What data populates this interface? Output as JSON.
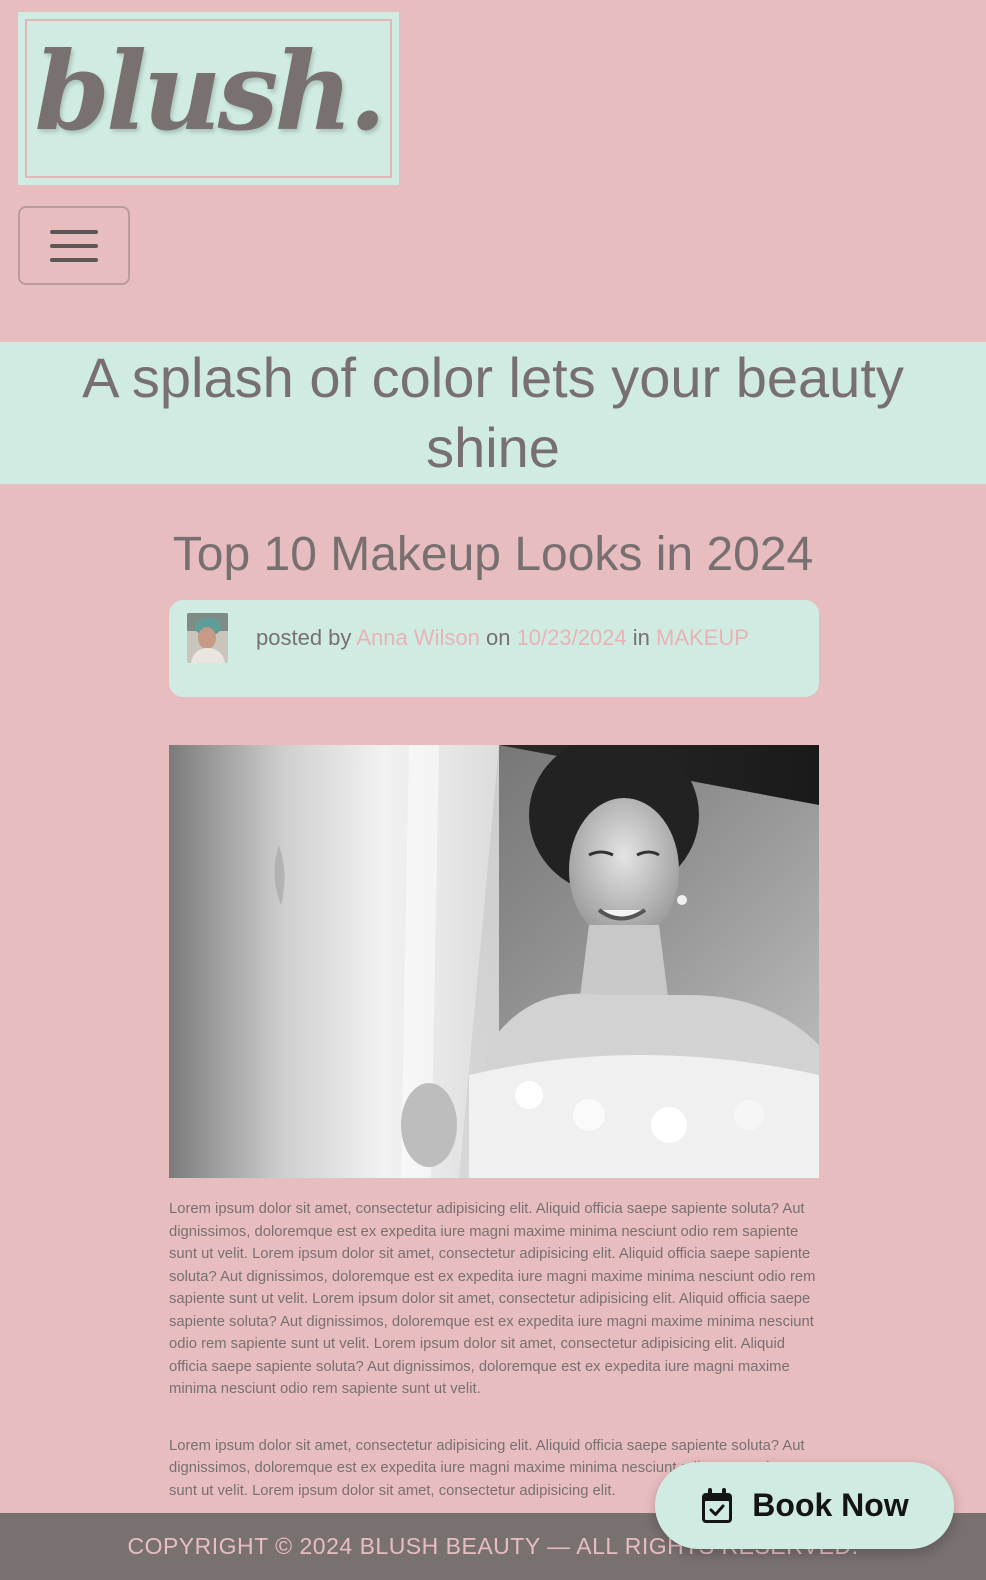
{
  "header": {
    "logo_text": "blush."
  },
  "banner": {
    "tagline": "A splash of color lets your beauty shine"
  },
  "post": {
    "title": "Top 10 Makeup Looks in 2024",
    "meta": {
      "posted_by_label": "posted by",
      "author": "Anna Wilson",
      "on_label": "on",
      "date": "10/23/2024",
      "in_label": "in",
      "category": "MAKEUP"
    },
    "paragraphs": [
      "Lorem ipsum dolor sit amet, consectetur adipisicing elit. Aliquid officia saepe sapiente soluta? Aut dignissimos, doloremque est ex expedita iure magni maxime minima nesciunt odio rem sapiente sunt ut velit. Lorem ipsum dolor sit amet, consectetur adipisicing elit. Aliquid officia saepe sapiente soluta? Aut dignissimos, doloremque est ex expedita iure magni maxime minima nesciunt odio rem sapiente sunt ut velit. Lorem ipsum dolor sit amet, consectetur adipisicing elit. Aliquid officia saepe sapiente soluta? Aut dignissimos, doloremque est ex expedita iure magni maxime minima nesciunt odio rem sapiente sunt ut velit. Lorem ipsum dolor sit amet, consectetur adipisicing elit. Aliquid officia saepe sapiente soluta? Aut dignissimos, doloremque est ex expedita iure magni maxime minima nesciunt odio rem sapiente sunt ut velit.",
      "Lorem ipsum dolor sit amet, consectetur adipisicing elit. Aliquid officia saepe sapiente soluta? Aut dignissimos, doloremque est ex expedita iure magni maxime minima nesciunt odio rem sapiente sunt ut velit. Lorem ipsum dolor sit amet, consectetur adipisicing elit."
    ]
  },
  "footer": {
    "copyright": "COPYRIGHT © 2024 BLUSH BEAUTY — ALL RIGHTS RESERVED."
  },
  "cta": {
    "book_now_label": "Book Now",
    "icon": "calendar-check-icon"
  },
  "colors": {
    "page_background": "#e8bdc0",
    "mint": "#d0ece2",
    "text_gray": "#787070",
    "link_pink": "#e8b3b6",
    "footer_bg": "#797070"
  }
}
